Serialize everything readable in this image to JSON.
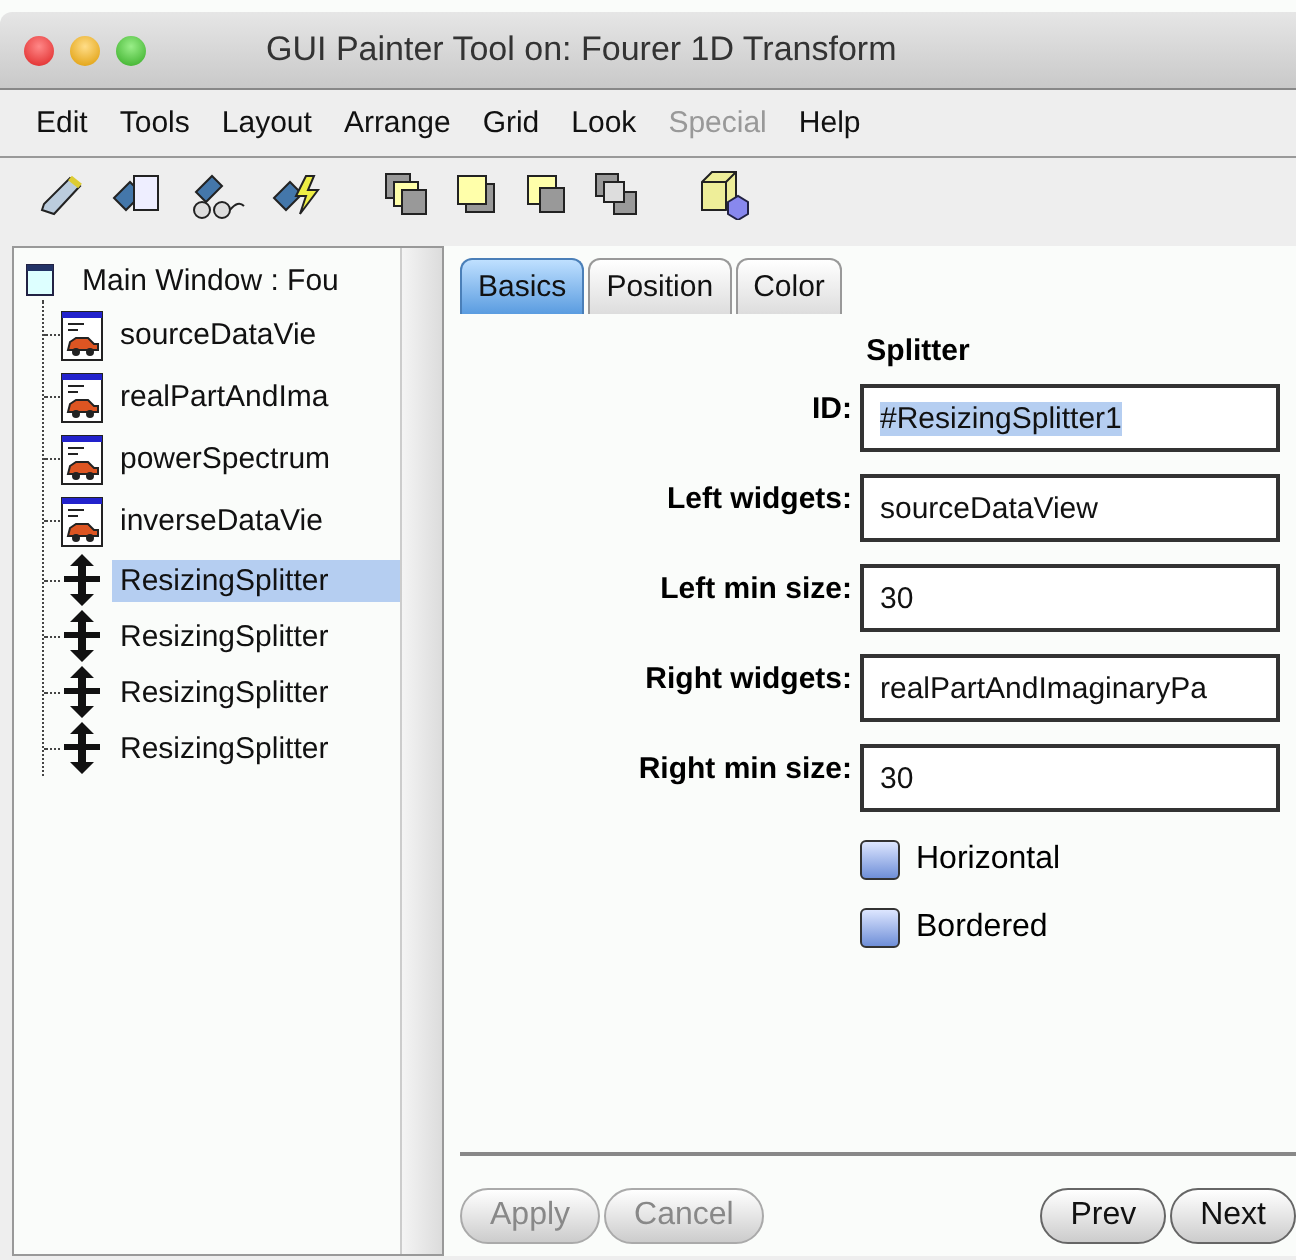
{
  "window": {
    "title": "GUI Painter Tool on: Fourer 1D Transform"
  },
  "menu": [
    {
      "label": "Edit",
      "disabled": false
    },
    {
      "label": "Tools",
      "disabled": false
    },
    {
      "label": "Layout",
      "disabled": false
    },
    {
      "label": "Arrange",
      "disabled": false
    },
    {
      "label": "Grid",
      "disabled": false
    },
    {
      "label": "Look",
      "disabled": false
    },
    {
      "label": "Special",
      "disabled": true
    },
    {
      "label": "Help",
      "disabled": false
    }
  ],
  "tree": {
    "label": "Main Window : Fou",
    "children": [
      {
        "label": "sourceDataVie",
        "kind": "view",
        "selected": false
      },
      {
        "label": "realPartAndIma",
        "kind": "view",
        "selected": false
      },
      {
        "label": "powerSpectrum",
        "kind": "view",
        "selected": false
      },
      {
        "label": "inverseDataVie",
        "kind": "view",
        "selected": false
      },
      {
        "label": "ResizingSplitter",
        "kind": "splitter",
        "selected": true
      },
      {
        "label": "ResizingSplitter",
        "kind": "splitter",
        "selected": false
      },
      {
        "label": "ResizingSplitter",
        "kind": "splitter",
        "selected": false
      },
      {
        "label": "ResizingSplitter",
        "kind": "splitter",
        "selected": false
      }
    ]
  },
  "tabs": [
    {
      "label": "Basics",
      "selected": true
    },
    {
      "label": "Position",
      "selected": false
    },
    {
      "label": "Color",
      "selected": false
    }
  ],
  "section_title": "Splitter",
  "fields": [
    {
      "label": "ID:",
      "value": "#ResizingSplitter1",
      "highlighted": true
    },
    {
      "label": "Left widgets:",
      "value": "sourceDataView",
      "highlighted": false
    },
    {
      "label": "Left min size:",
      "value": "30",
      "highlighted": false
    },
    {
      "label": "Right widgets:",
      "value": "realPartAndImaginaryPa",
      "highlighted": false
    },
    {
      "label": "Right min size:",
      "value": "30",
      "highlighted": false
    }
  ],
  "checkboxes": [
    {
      "label": "Horizontal",
      "checked": false
    },
    {
      "label": "Bordered",
      "checked": false
    }
  ],
  "edit_buttons": [
    {
      "label": "Apply",
      "disabled": true
    },
    {
      "label": "Cancel",
      "disabled": true
    }
  ],
  "nav_buttons": [
    {
      "label": "Prev",
      "disabled": false
    },
    {
      "label": "Next",
      "disabled": false
    }
  ]
}
